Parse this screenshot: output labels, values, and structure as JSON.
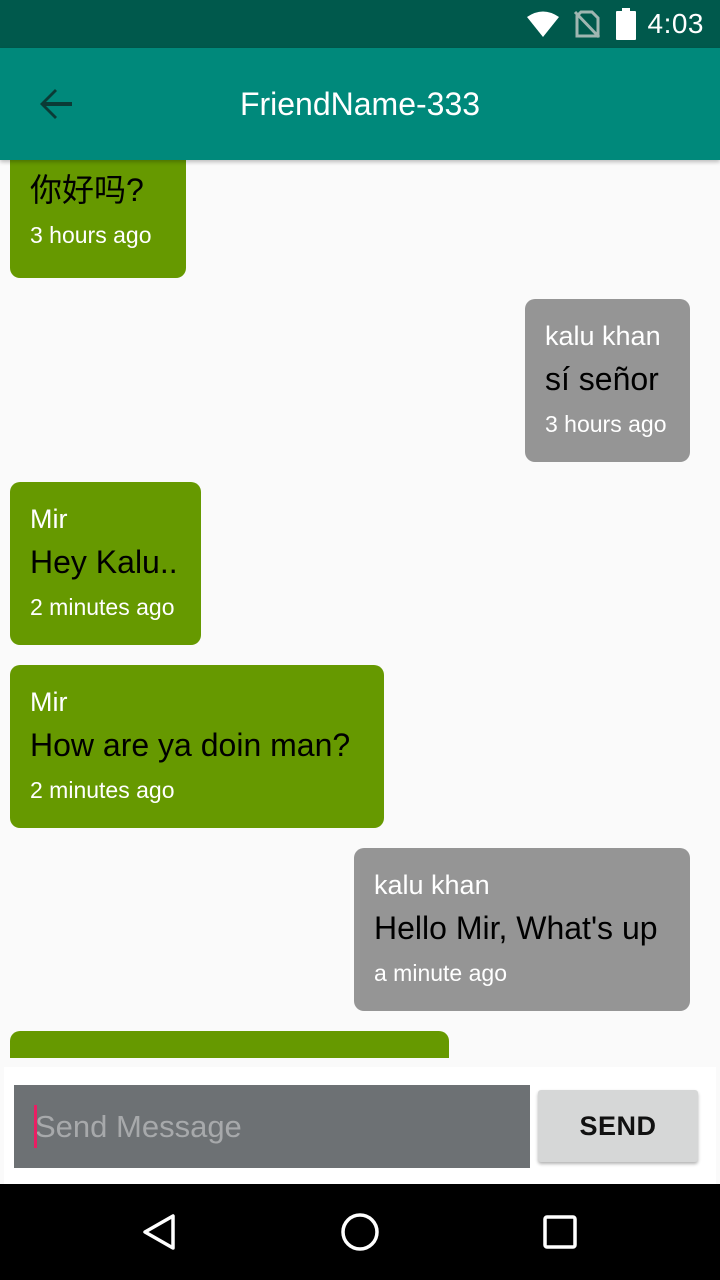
{
  "status_bar": {
    "time": "4:03",
    "icons": [
      "wifi-icon",
      "no-sim-icon",
      "battery-icon"
    ]
  },
  "app_bar": {
    "title": "FriendName-333",
    "back_icon": "arrow-back-icon"
  },
  "messages": [
    {
      "direction": "in",
      "sender": "",
      "text": "你好吗?",
      "time": "3 hours ago"
    },
    {
      "direction": "out",
      "sender": "kalu khan",
      "text": "sí señor",
      "time": "3 hours ago"
    },
    {
      "direction": "in",
      "sender": "Mir",
      "text": "Hey Kalu..",
      "time": "2 minutes ago"
    },
    {
      "direction": "in",
      "sender": "Mir",
      "text": "How are ya doin man?",
      "time": "2 minutes ago"
    },
    {
      "direction": "out",
      "sender": "kalu khan",
      "text": "Hello Mir, What's up",
      "time": "a minute ago"
    },
    {
      "direction": "in",
      "sender": "",
      "text": "",
      "time": ""
    }
  ],
  "composer": {
    "input_value": "",
    "placeholder": "Send Message",
    "send_label": "SEND"
  },
  "nav_bar": {
    "icons": [
      "back-triangle-icon",
      "home-circle-icon",
      "recents-square-icon"
    ]
  },
  "colors": {
    "status_bar": "#00594c",
    "app_bar": "#00897b",
    "incoming_bubble": "#669900",
    "outgoing_bubble": "#959595",
    "input_background": "#6d7174",
    "caret": "#e91e63"
  }
}
